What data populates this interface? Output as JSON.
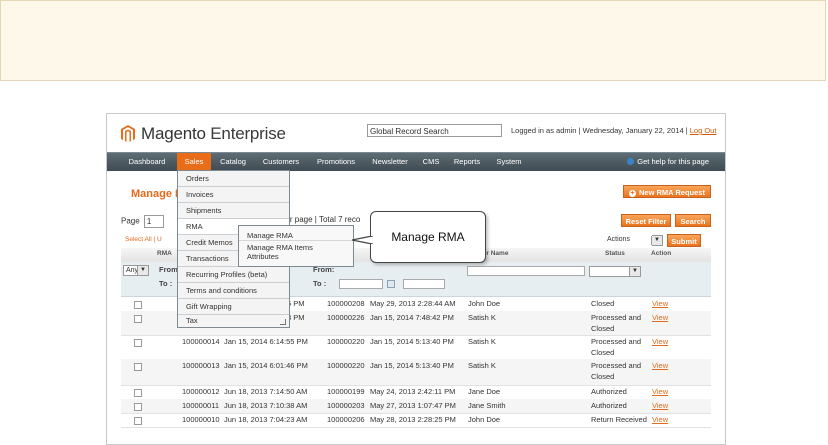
{
  "header": {
    "brand": "Magento",
    "brand_suffix": "Enterprise",
    "search_value": "Global Record Search",
    "user_info": "Logged in as admin  |  Wednesday, January 22, 2014  |",
    "logout_label": "Log Out"
  },
  "nav": {
    "items": [
      "Dashboard",
      "Sales",
      "Catalog",
      "Customers",
      "Promotions",
      "Newsletter",
      "CMS",
      "Reports",
      "System"
    ],
    "help_label": "Get help for this page"
  },
  "sales_menu": {
    "items": [
      "Orders",
      "Invoices",
      "Shipments",
      "RMA",
      "Credit Memos",
      "Transactions",
      "Recurring Profiles (beta)",
      "Terms and conditions",
      "Gift Wrapping",
      "Tax"
    ]
  },
  "rma_submenu": {
    "items": [
      "Manage RMA",
      "Manage RMA Items Attributes"
    ]
  },
  "callout": {
    "text": "Manage RMA"
  },
  "page": {
    "title": "Manage R",
    "new_button": "New RMA Request",
    "reset_button": "Reset Filter",
    "search_button": "Search",
    "pager_label": "Page",
    "pager_value": "1",
    "per_page_text": "per page  |  Total 7 reco",
    "select_all": "Select All  |  U",
    "actions_label": "Actions",
    "submit_button": "Submit"
  },
  "grid": {
    "columns": [
      "RMA",
      "mer Name",
      "Status",
      "Action"
    ],
    "filter": {
      "any_value": "Any",
      "from_label": "From",
      "to_label": "To :",
      "from_label2": "From:",
      "to_label2": "To :"
    },
    "rows": [
      {
        "rma": "",
        "date": "6 PM",
        "order": "100000208",
        "order_date": "May 29, 2013 2:28:44 AM",
        "customer": "John Doe",
        "status": "Closed",
        "status2": "",
        "action": "View"
      },
      {
        "rma": "",
        "date": "8 PM",
        "order": "100000226",
        "order_date": "Jan 15, 2014 7:48:42 PM",
        "customer": "Satish K",
        "status": "Processed and",
        "status2": "Closed",
        "action": "View"
      },
      {
        "rma": "100000014",
        "date": "Jan 15, 2014 6:14:55 PM",
        "order": "100000220",
        "order_date": "Jan 15, 2014 5:13:40 PM",
        "customer": "Satish K",
        "status": "Processed and",
        "status2": "Closed",
        "action": "View"
      },
      {
        "rma": "100000013",
        "date": "Jan 15, 2014 6:01:46 PM",
        "order": "100000220",
        "order_date": "Jan 15, 2014 5:13:40 PM",
        "customer": "Satish K",
        "status": "Processed and",
        "status2": "Closed",
        "action": "View"
      },
      {
        "rma": "100000012",
        "date": "Jun 18, 2013 7:14:50 AM",
        "order": "100000199",
        "order_date": "May 24, 2013 2:42:11 PM",
        "customer": "Jane Doe",
        "status": "Authorized",
        "status2": "",
        "action": "View"
      },
      {
        "rma": "100000011",
        "date": "Jun 18, 2013 7:10:38 AM",
        "order": "100000203",
        "order_date": "May 27, 2013 1:07:47 PM",
        "customer": "Jane Smith",
        "status": "Authorized",
        "status2": "",
        "action": "View"
      },
      {
        "rma": "100000010",
        "date": "Jun 18, 2013 7:04:23 AM",
        "order": "100000206",
        "order_date": "May 28, 2013 2:28:25 PM",
        "customer": "John Doe",
        "status": "Return Received",
        "status2": "",
        "action": "View"
      }
    ]
  },
  "colors": {
    "accent": "#e96d18",
    "nav_bg": "#4a5860",
    "note_bg": "#fdf8ea"
  }
}
